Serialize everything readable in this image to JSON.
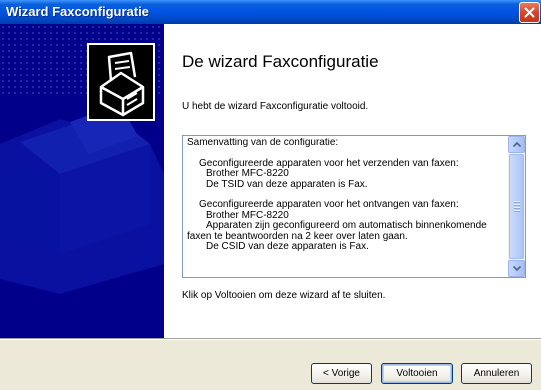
{
  "window": {
    "title": "Wizard Faxconfiguratie"
  },
  "page": {
    "heading": "De wizard Faxconfiguratie",
    "intro": "U hebt de wizard Faxconfiguratie voltooid.",
    "summary_lines": [
      "Samenvatting van de configuratie:",
      "Geconfigureerde apparaten voor het verzenden van faxen:",
      "Brother MFC-8220",
      "De TSID van deze apparaten is Fax.",
      "Geconfigureerde apparaten voor het ontvangen van faxen:",
      "Brother MFC-8220",
      "Apparaten zijn geconfigureerd om automatisch binnenkomende",
      "faxen te beantwoorden na 2 keer over laten gaan.",
      "De CSID van deze apparaten is Fax."
    ],
    "closing": "Klik op Voltooien om deze wizard af te sluiten."
  },
  "buttons": {
    "back": "< Vorige",
    "finish": "Voltooien",
    "cancel": "Annuleren"
  },
  "icons": {
    "close": "close-icon",
    "logo": "fax-wizard-logo-icon",
    "scroll_up": "scroll-up-arrow-icon",
    "scroll_down": "scroll-down-arrow-icon"
  },
  "colors": {
    "titlebar": "#0055e5",
    "left_panel": "#00008a",
    "dialog_face": "#ece9d8",
    "close_button": "#d9452a"
  }
}
